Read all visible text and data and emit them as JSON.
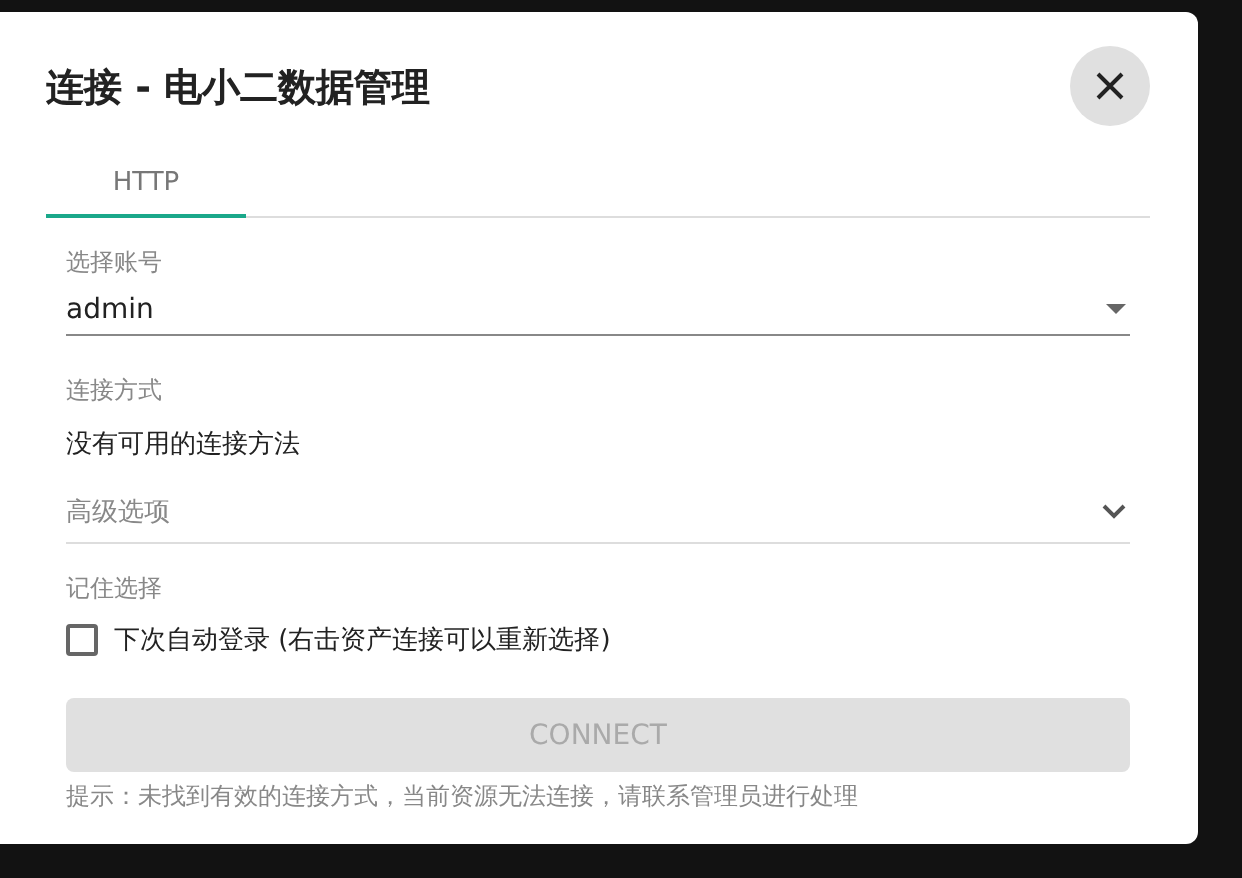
{
  "dialog": {
    "title": "连接 - 电小二数据管理",
    "tabs": [
      {
        "label": "HTTP",
        "selected": true
      }
    ],
    "account": {
      "label": "选择账号",
      "value": "admin"
    },
    "connect_method": {
      "label": "连接方式",
      "message": "没有可用的连接方法"
    },
    "advanced": {
      "label": "高级选项",
      "expanded": false
    },
    "remember": {
      "label": "记住选择",
      "checkbox_label": "下次自动登录 (右击资产连接可以重新选择)",
      "checked": false
    },
    "connect_button": {
      "label": "CONNECT",
      "disabled": true
    },
    "hint": "提示：未找到有效的连接方式，当前资源无法连接，请联系管理员进行处理"
  }
}
